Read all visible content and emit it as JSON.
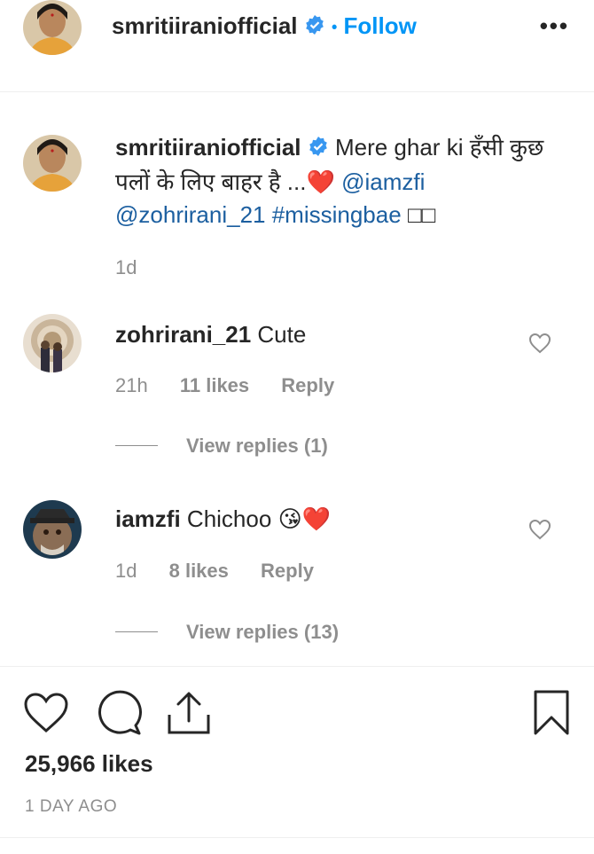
{
  "header": {
    "username": "smritiiraniofficial",
    "separator": "•",
    "follow_label": "Follow",
    "more_label": "•••"
  },
  "caption": {
    "username": "smritiiraniofficial",
    "text": "Mere ghar ki हँसी कुछ पलों के लिए बाहर है ...",
    "emoji": "❤️",
    "mention1": "@iamzfi",
    "mention2": "@zohrirani_21",
    "hashtag": "#missingbae",
    "trailing": "□□",
    "time": "1d"
  },
  "comments": [
    {
      "username": "zohrirani_21",
      "text": "Cute",
      "time": "21h",
      "likes": "11 likes",
      "reply": "Reply",
      "view_replies": "View replies (1)"
    },
    {
      "username": "iamzfi",
      "text": "Chichoo",
      "emoji": "😘❤️",
      "time": "1d",
      "likes": "8 likes",
      "reply": "Reply",
      "view_replies": "View replies (13)"
    }
  ],
  "footer": {
    "likes_count": "25,966 likes",
    "date": "1 DAY AGO"
  },
  "icons": {
    "verified": "verified-badge-icon",
    "like": "heart-icon",
    "comment": "comment-bubble-icon",
    "share": "share-icon",
    "save": "bookmark-icon",
    "more": "more-options-icon"
  },
  "colors": {
    "follow": "#0095f6",
    "link": "#00376b",
    "verified": "#3897f0",
    "muted": "#8e8e8e"
  }
}
